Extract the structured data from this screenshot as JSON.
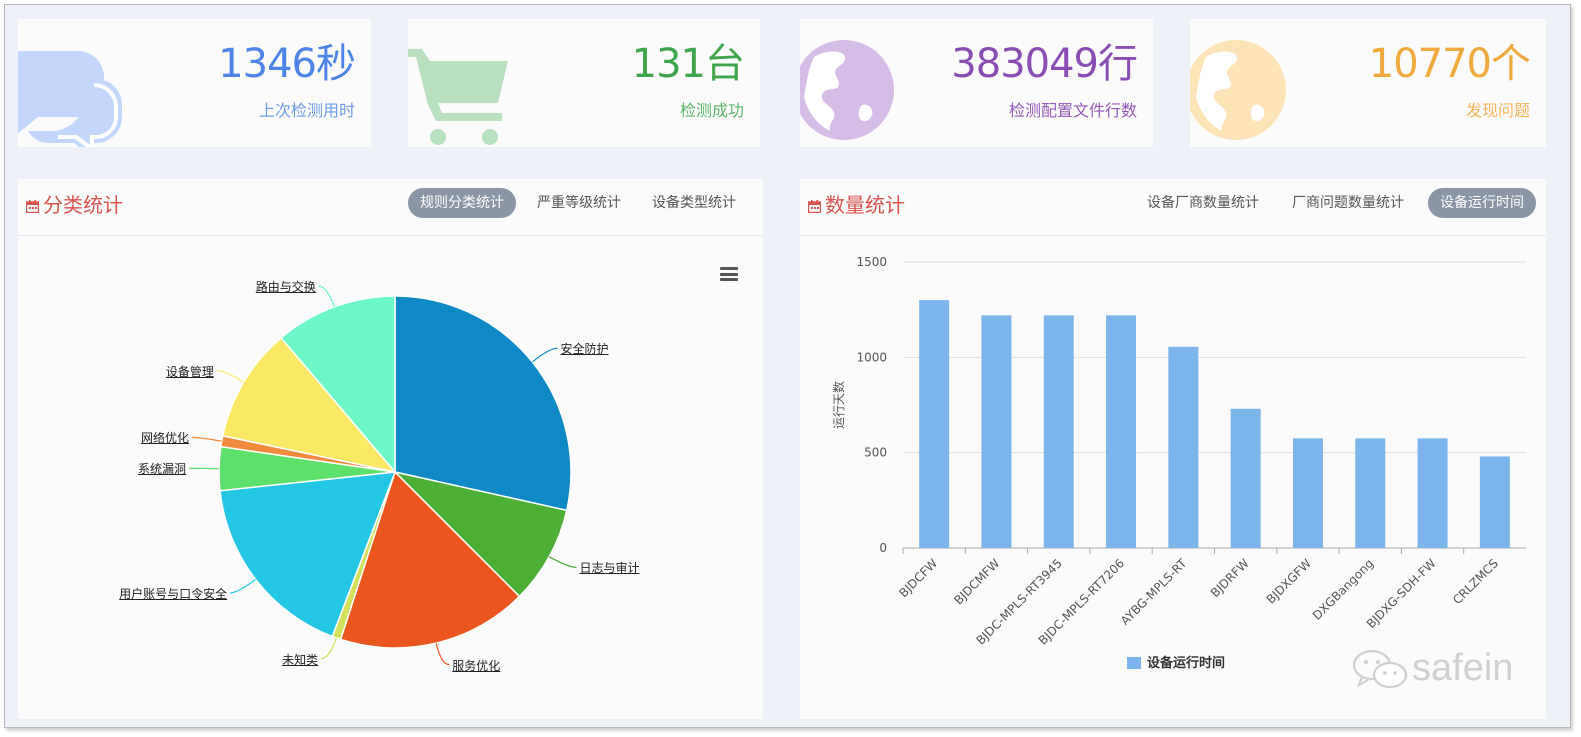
{
  "stats": [
    {
      "value": "1346秒",
      "label": "上次检测用时",
      "color": "#4c84e8",
      "label_color": "#6f9de8",
      "icon": "chat-bubbles-icon"
    },
    {
      "value": "131台",
      "label": "检测成功",
      "color": "#3fa54b",
      "label_color": "#5db66a",
      "icon": "shopping-cart-icon"
    },
    {
      "value": "383049行",
      "label": "检测配置文件行数",
      "color": "#8a4db4",
      "label_color": "#9558bd",
      "icon": "globe-icon"
    },
    {
      "value": "10770个",
      "label": "发现问题",
      "color": "#f0a93c",
      "label_color": "#f3b45c",
      "icon": "globe-icon"
    }
  ],
  "left_panel": {
    "title": "分类统计",
    "tabs": [
      {
        "label": "规则分类统计",
        "active": true
      },
      {
        "label": "严重等级统计",
        "active": false
      },
      {
        "label": "设备类型统计",
        "active": false
      }
    ]
  },
  "right_panel": {
    "title": "数量统计",
    "tabs": [
      {
        "label": "设备厂商数量统计",
        "active": false
      },
      {
        "label": "厂商问题数量统计",
        "active": false
      },
      {
        "label": "设备运行时间",
        "active": true
      }
    ]
  },
  "watermark": {
    "text": "safein"
  },
  "chart_data": [
    {
      "type": "pie",
      "title": "",
      "slices": [
        {
          "name": "安全防护",
          "value": 28.5,
          "color": "#0d89c6"
        },
        {
          "name": "日志与审计",
          "value": 9.0,
          "color": "#4daf35"
        },
        {
          "name": "服务优化",
          "value": 17.5,
          "color": "#ea561d"
        },
        {
          "name": "未知类",
          "value": 0.8,
          "color": "#d3e05c"
        },
        {
          "name": "用户账号与口令安全",
          "value": 17.5,
          "color": "#24c7e3"
        },
        {
          "name": "系统漏洞",
          "value": 4.0,
          "color": "#5ee06c"
        },
        {
          "name": "网络优化",
          "value": 1.0,
          "color": "#f08a3c"
        },
        {
          "name": "设备管理",
          "value": 10.5,
          "color": "#fbe864"
        },
        {
          "name": "路由与交换",
          "value": 11.2,
          "color": "#6bf7c6"
        }
      ]
    },
    {
      "type": "bar",
      "title": "",
      "categories": [
        "BJDCFW",
        "BJDCMFW",
        "BJDC-MPLS-RT3945",
        "BJDC-MPLS-RT7206",
        "AYBG-MPLS-RT",
        "BJDRFW",
        "BJDXGFW",
        "DXGBangong",
        "BJDXG-SDH-FW",
        "CRLZMCS"
      ],
      "series": [
        {
          "name": "设备运行时间",
          "values": [
            1300,
            1220,
            1220,
            1220,
            1055,
            730,
            575,
            575,
            575,
            480
          ],
          "color": "#7cb5ec"
        }
      ],
      "ylabel": "运行天数",
      "xlabel": "",
      "ylim": [
        0,
        1500
      ],
      "yticks": [
        0,
        500,
        1000,
        1500
      ],
      "grid": true,
      "legend": "bottom"
    }
  ]
}
